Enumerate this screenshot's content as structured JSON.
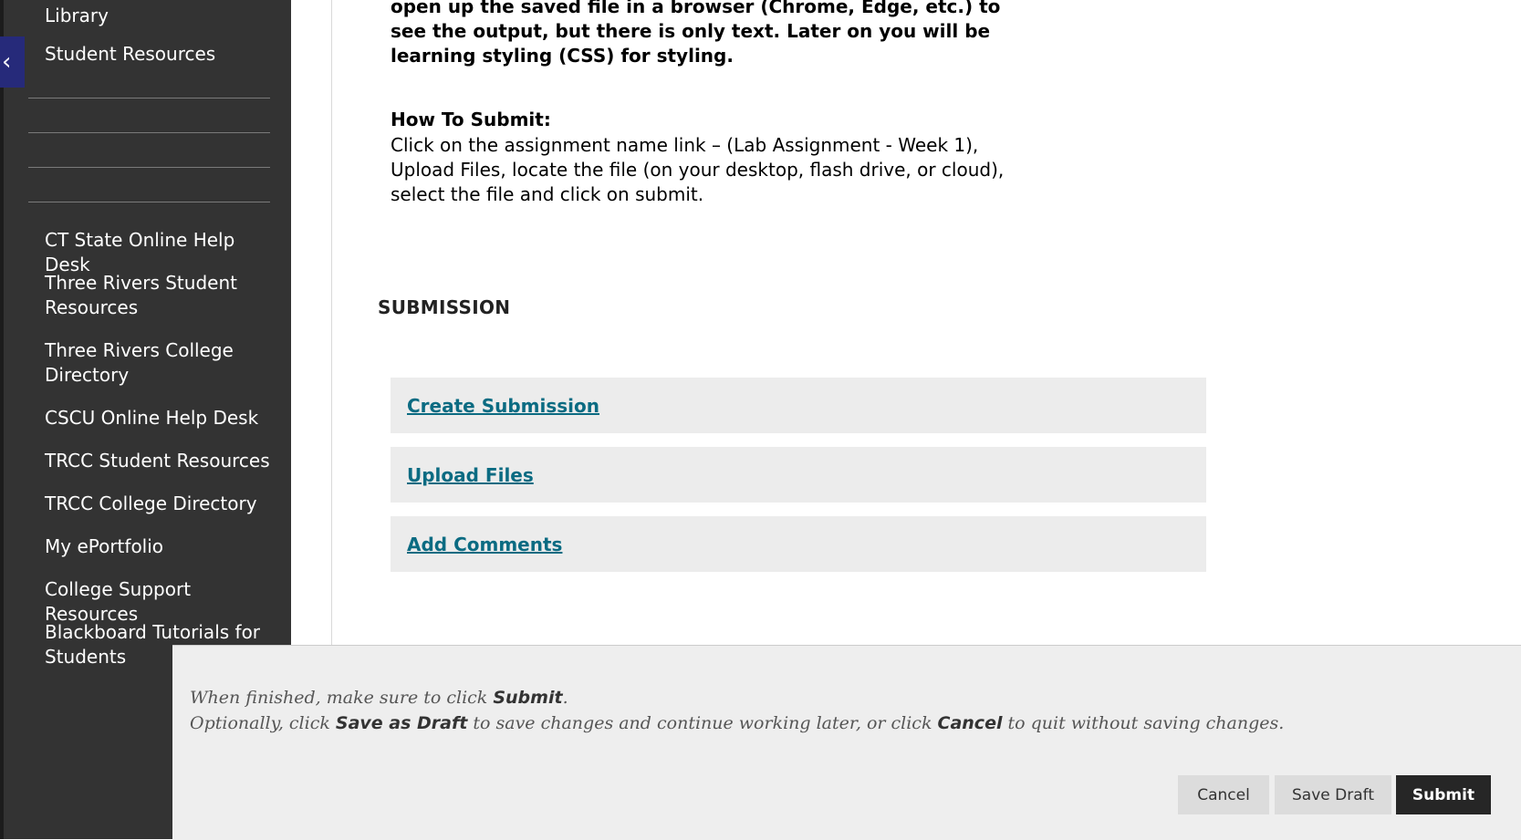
{
  "sidebar": {
    "collapse_icon": "chevron-left-icon",
    "top_items": [
      "Library",
      "Student Resources"
    ],
    "items": [
      "CT State Online Help Desk",
      "Three Rivers Student Resources",
      "Three Rivers College Directory",
      "CSCU Online Help Desk",
      "TRCC Student Resources",
      "TRCC College Directory",
      "My ePortfolio",
      "College Support Resources",
      "Blackboard Tutorials for Students"
    ]
  },
  "instructions": {
    "partial_lines": "open up the saved file in a browser (Chrome, Edge, etc.) to see the output, but there is only text.  Later on you will be learning styling (CSS) for styling.",
    "how_to_submit_heading": "How To Submit:",
    "how_to_submit_body": "Click on the assignment name link – (Lab Assignment - Week 1), Upload Files, locate the file (on your desktop, flash drive, or cloud), select the file and click on submit."
  },
  "submission": {
    "heading": "SUBMISSION",
    "links": [
      "Create Submission",
      "Upload Files",
      "Add Comments"
    ]
  },
  "submit_bar": {
    "line1_pre": "When finished, make sure to click ",
    "line1_bold": "Submit",
    "line1_post": ".",
    "line2_pre": "Optionally, click ",
    "line2_bold1": "Save as Draft",
    "line2_mid": " to save changes and continue working later, or click ",
    "line2_bold2": "Cancel",
    "line2_post": " to quit without saving changes.",
    "cancel_label": "Cancel",
    "save_draft_label": "Save Draft",
    "submit_label": "Submit"
  },
  "colors": {
    "sidebar_bg": "#333333",
    "link": "#0b6b82",
    "collapse_tab": "#262a7a",
    "submit_button": "#262626"
  }
}
